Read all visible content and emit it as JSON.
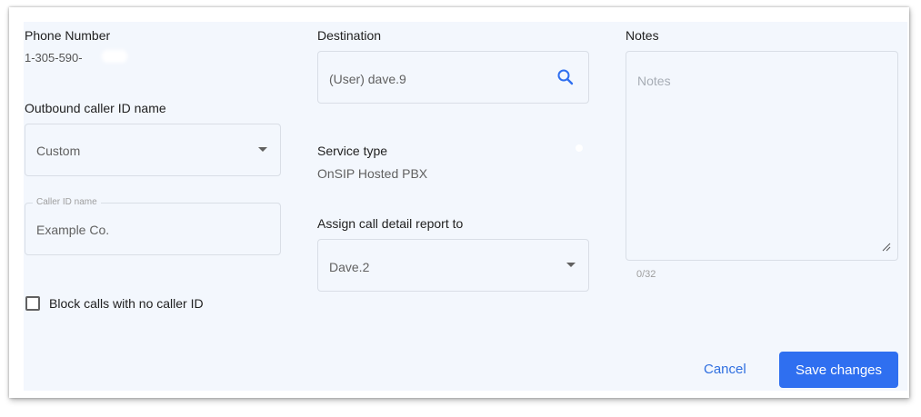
{
  "phone": {
    "label": "Phone Number",
    "value": "1-305-590-"
  },
  "caller_id_name_select": {
    "label": "Outbound caller ID name",
    "selected": "Custom"
  },
  "caller_id_name_field": {
    "floating_label": "Caller ID name",
    "value": "Example Co."
  },
  "block_calls": {
    "label": "Block calls with no caller ID",
    "checked": false
  },
  "destination": {
    "label": "Destination",
    "value": "(User) dave.9",
    "icon": "search-icon"
  },
  "service_type": {
    "label": "Service type",
    "value": "OnSIP Hosted PBX"
  },
  "cdr": {
    "label": "Assign call detail report to",
    "selected": "Dave.2"
  },
  "notes": {
    "label": "Notes",
    "placeholder": "Notes",
    "counter": "0/32"
  },
  "actions": {
    "cancel": "Cancel",
    "save": "Save changes"
  },
  "colors": {
    "panel_bg": "#f3f7fd",
    "accent": "#2f6ff0",
    "border": "#d9dee6"
  }
}
